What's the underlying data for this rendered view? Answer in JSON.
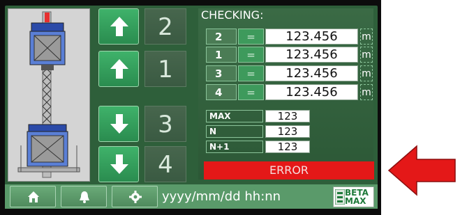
{
  "checking": {
    "title": "CHECKING:",
    "rows": [
      {
        "index": "2",
        "eq": "=",
        "value": "123.456",
        "unit": "m"
      },
      {
        "index": "1",
        "eq": "=",
        "value": "123.456",
        "unit": "m"
      },
      {
        "index": "3",
        "eq": "=",
        "value": "123.456",
        "unit": "m"
      },
      {
        "index": "4",
        "eq": "=",
        "value": "123.456",
        "unit": "m"
      }
    ]
  },
  "stats": [
    {
      "label": "MAX",
      "value": "123"
    },
    {
      "label": "N",
      "value": "123"
    },
    {
      "label": "N+1",
      "value": "123"
    }
  ],
  "status": {
    "error_label": "ERROR",
    "error_color": "#e41818"
  },
  "floor_buttons": [
    {
      "direction": "up",
      "icon": "arrow-up-icon",
      "floor": "2"
    },
    {
      "direction": "up",
      "icon": "arrow-up-icon",
      "floor": "1"
    },
    {
      "direction": "down",
      "icon": "arrow-down-icon",
      "floor": "3"
    },
    {
      "direction": "down",
      "icon": "arrow-down-icon",
      "floor": "4"
    }
  ],
  "footer": {
    "datetime": "yyyy/mm/dd hh:nn",
    "buttons": [
      "home-icon",
      "bell-icon",
      "gear-icon"
    ],
    "logo_line1": "BETA",
    "logo_line2": "MAX"
  },
  "colors": {
    "screen_bg": "#2e5f3a",
    "button_green": "#3fb26a",
    "callout_arrow": "#e41818"
  }
}
